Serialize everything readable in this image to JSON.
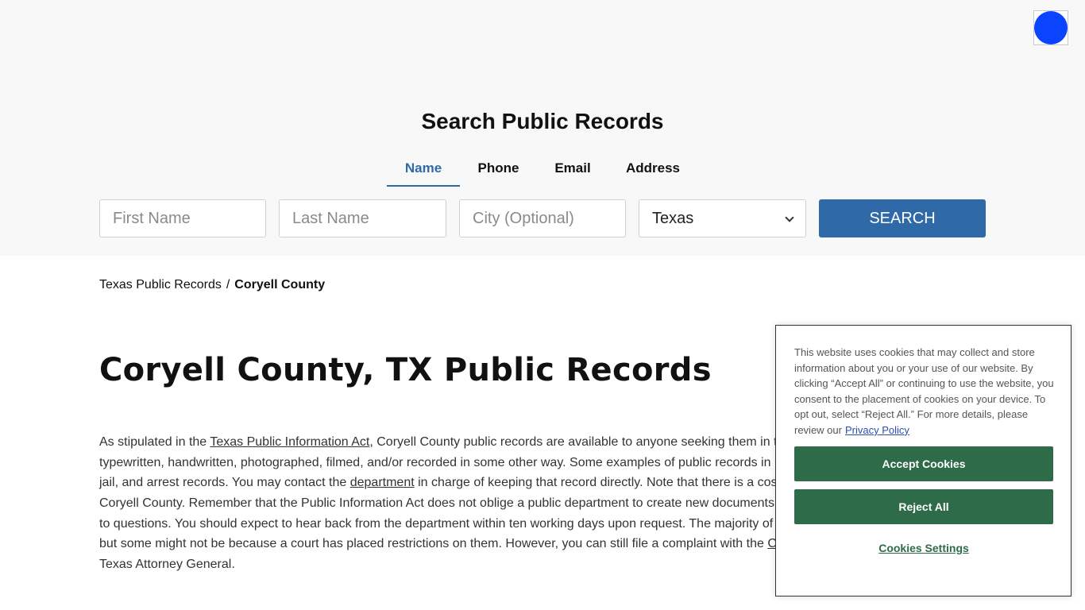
{
  "search": {
    "title": "Search Public Records",
    "tabs": [
      {
        "label": "Name",
        "active": true
      },
      {
        "label": "Phone",
        "active": false
      },
      {
        "label": "Email",
        "active": false
      },
      {
        "label": "Address",
        "active": false
      }
    ],
    "first_name_placeholder": "First Name",
    "last_name_placeholder": "Last Name",
    "city_placeholder": "City (Optional)",
    "state_value": "Texas",
    "button_label": "SEARCH"
  },
  "breadcrumb": {
    "parent": "Texas Public Records",
    "separator": "/",
    "current": "Coryell County"
  },
  "page_title": "Coryell County, TX Public Records",
  "body": {
    "line1_pre": "As stipulated in the ",
    "line1_link": "Texas Public Information Act",
    "line1_post": ", Coryell County public records are available to anyone seeking them in t",
    "line2": "typewritten, handwritten, photographed, filmed, and/or recorded in some other way. Some examples of public records in",
    "line3_pre": "jail, and arrest records. You may contact the ",
    "line3_link": "department",
    "line3_post": " in charge of keeping that record directly. Note that there is a cos",
    "line4": "Coryell County. Remember that the Public Information Act does not oblige a public department to create new documents",
    "line5": "to questions. You should expect to hear back from the department within ten working days upon request. The majority of",
    "line6_pre": "but some might not be because a court has placed restrictions on them. However, you can still file a complaint with the ",
    "line6_link": "C",
    "line7": "Texas Attorney General."
  },
  "cookie": {
    "text": "This website uses cookies that may collect and store information about you or your use of our website. By clicking “Accept All” or continuing to use the website, you consent to the placement of cookies on your device. To opt out, select “Reject All.” For more details, please review our",
    "privacy_link": "Privacy Policy",
    "accept_label": "Accept Cookies",
    "reject_label": "Reject All",
    "settings_label": "Cookies Settings"
  },
  "colors": {
    "accent": "#2f69a8",
    "cookie_button": "#2e6b48",
    "avatar": "#0a44ff",
    "hero_background": "#f8f8f8"
  }
}
